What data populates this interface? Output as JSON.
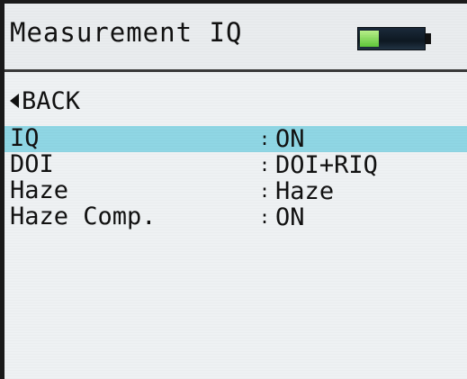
{
  "header": {
    "title": "Measurement IQ",
    "battery_level": 0.3,
    "battery_color": "#6fd44a"
  },
  "nav": {
    "back_label": "BACK",
    "back_icon": "left-triangle-icon"
  },
  "menu": {
    "selected_index": 0,
    "selection_color": "#8fd6e4",
    "items": [
      {
        "label": "IQ",
        "value": "ON"
      },
      {
        "label": "DOI",
        "value": "DOI+RIQ"
      },
      {
        "label": "Haze",
        "value": "Haze"
      },
      {
        "label": "Haze Comp.",
        "value": "ON"
      }
    ]
  }
}
